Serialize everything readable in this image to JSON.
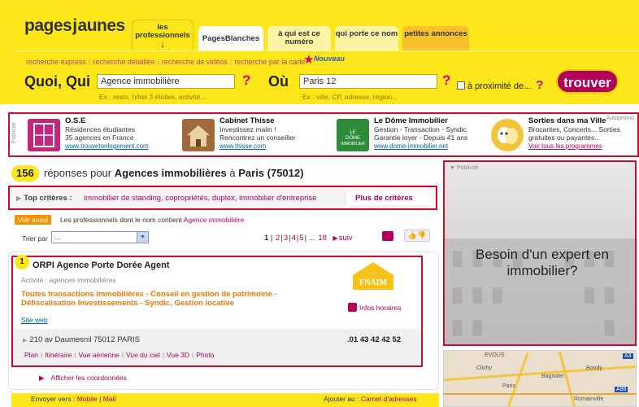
{
  "header": {
    "logo": {
      "left": "pages",
      "j": "j",
      "right": "aunes"
    },
    "tabs": [
      {
        "label": "les professionnels",
        "arrow": "↓"
      },
      {
        "label": "PagesBlanches"
      },
      {
        "label": "à qui est ce numéro"
      },
      {
        "label": "qui porte ce nom"
      },
      {
        "label": "petites annonces"
      }
    ]
  },
  "search": {
    "links": [
      "recherche express",
      "recherche détaillée",
      "recherche de vidéos",
      "recherche par la carte"
    ],
    "nouveau": "Nouveau",
    "quoi_label": "Quoi, Qui",
    "quoi_value": "Agence immobilière",
    "quoi_hint": "Ex : resto, hôtel 3 étoiles, activité...",
    "ou_label": "Où",
    "ou_value": "Paris 12",
    "ou_hint": "Ex : ville, CP, adresse, région...",
    "qmark": "?",
    "proximite": "à proximité de...",
    "trouver": "trouver"
  },
  "pubs": {
    "label": "Publicité",
    "autopromo": "Autopromo",
    "items": [
      {
        "title": "O.S.E",
        "lines": [
          "Résidences étudiantes",
          "35 agences en France"
        ],
        "link": "www.trouvetonlogement.com",
        "color": "#c4267f"
      },
      {
        "title": "Cabinet Thisse",
        "lines": [
          "Investissez malin !",
          "Rencontrez un conseiller"
        ],
        "link": "www.thisse.com",
        "color": "#8b5a2b"
      },
      {
        "title": "Le Dôme Immobilier",
        "lines": [
          "Gestion - Transaction - Syndic",
          "Garantie loyer - Depuis 41 ans"
        ],
        "link": "www.dome-immobilier.net",
        "color": "#2e8b3a"
      },
      {
        "title": "Sorties dans ma Ville",
        "lines": [
          "Brocantes, Concerts... Sorties",
          "gratuites ou payantes..."
        ],
        "link": "Voir tous les programmes",
        "color": "#f3c43a"
      }
    ]
  },
  "results": {
    "count": "156",
    "text_pre": "réponses pour",
    "query": "Agences immobilières",
    "text_mid": "à",
    "place": "Paris (75012)",
    "criteria_label": "Top critères :",
    "criteria_links": "immobilier de standing, copropriétés, duplex, immobilier d'entreprise",
    "plus": "Plus de critères",
    "voir_aussi": "Voir aussi",
    "voir_text": "Les professionnels dont le nom contient",
    "voir_link": "Agence immobilière",
    "trier_label": "Trier par",
    "trier_value": "...",
    "pager": {
      "current": "1",
      "pages": [
        "2",
        "3",
        "4",
        "5"
      ],
      "ellipsis": "...",
      "last": "18",
      "next": "suiv"
    }
  },
  "result_item": {
    "rank": "1",
    "name": "ORPI Agence Porte Dorée Agent",
    "activity": "Activité :  agences immobilières",
    "desc": "Toutes transactions immobilières - Conseil en gestion de patrimoine - Défiscalisation Investissements - Syndic, Gestion locative",
    "site": "Site web",
    "fnaim": "FNAIM",
    "horaires": "Infos horaires",
    "address": "210 av Daumesnil 75012 PARIS",
    "phone": ".01 43 42 42 52",
    "links": [
      "Plan",
      "Itinéraire",
      "Vue aérienne",
      "Vue du ciel",
      "Vue 3D",
      "Photo"
    ],
    "afficher": "Afficher les coordonnées"
  },
  "footer": {
    "envoyer": "Envoyer vers :",
    "mobile": "Mobile",
    "mail": "Mail",
    "ajouter": "Ajouter au :",
    "carnet": "Carnet d'adresses"
  },
  "ad": {
    "label": "Publicité",
    "text": "Besoin d'un expert en immobilier?"
  },
  "map": {
    "labels": [
      "EVOUS",
      "A3",
      "Bondy",
      "Bagnolet",
      "Paris",
      "Romainville",
      "A86",
      "Clichy"
    ]
  },
  "colors": {
    "brand_yellow": "#fde71b",
    "brand_magenta": "#b3005a",
    "highlight_red": "#c8102e",
    "orange": "#f07800"
  }
}
